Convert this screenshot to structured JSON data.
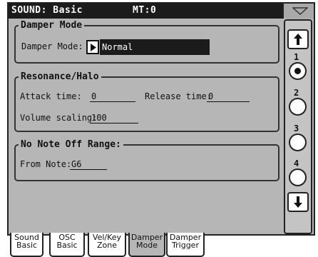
{
  "header": {
    "title": "SOUND: Basic",
    "mode": "MT:0"
  },
  "damper_mode": {
    "title": "Damper Mode",
    "label": "Damper Mode:",
    "value": "Normal"
  },
  "resonance": {
    "title": "Resonance/Halo",
    "attack_label": "Attack time:",
    "attack_value": "0",
    "release_label": "Release time:",
    "release_value": "0",
    "volume_label": "Volume scaling:",
    "volume_value": "100"
  },
  "no_note_off": {
    "title": "No Note Off Range:",
    "from_label": "From Note:",
    "from_value": "G6"
  },
  "pages": {
    "p1": "1",
    "p2": "2",
    "p3": "3",
    "p4": "4",
    "selected": "1"
  },
  "tabs": [
    {
      "line1": "Sound",
      "line2": "Basic"
    },
    {
      "line1": "OSC",
      "line2": "Basic"
    },
    {
      "line1": "Vel/Key",
      "line2": "Zone"
    },
    {
      "line1": "Damper",
      "line2": "Mode"
    },
    {
      "line1": "Damper",
      "line2": "Trigger"
    }
  ],
  "active_tab": "Damper Mode",
  "icons": [
    "menu-triangle-icon",
    "arrow-up-icon",
    "arrow-down-icon",
    "play-triangle-icon"
  ]
}
